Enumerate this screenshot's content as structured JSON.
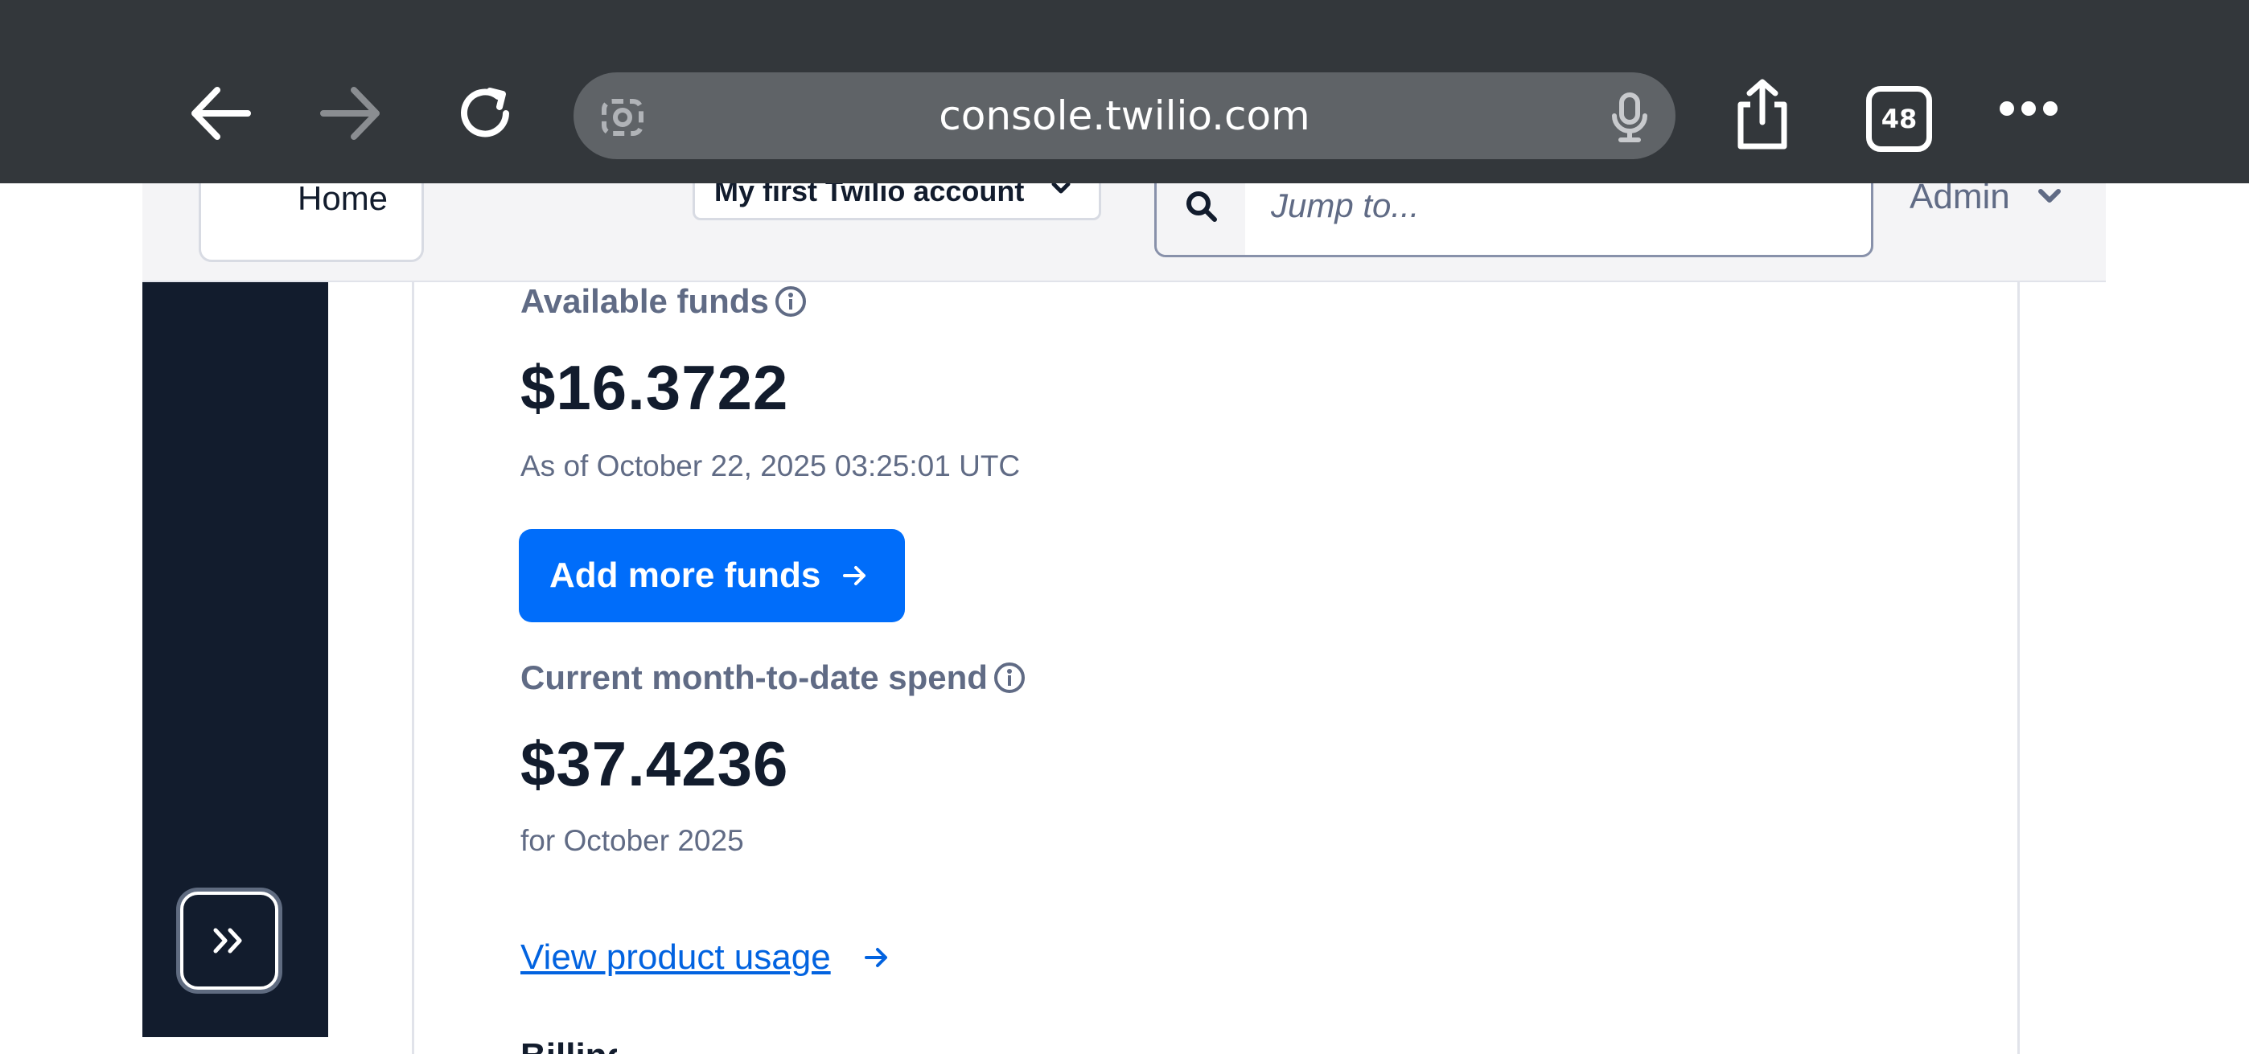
{
  "browser": {
    "url": "console.twilio.com",
    "tabs_count": "48"
  },
  "header": {
    "home_label": "Home",
    "account_selector": "My first Twilio account",
    "search_placeholder": "Jump to...",
    "admin_label": "Admin"
  },
  "billing": {
    "available_funds_label": "Available funds",
    "available_funds_amount": "$16.3722",
    "available_funds_asof": "As of October 22, 2025 03:25:01 UTC",
    "add_funds_button": "Add more funds",
    "mtd_spend_label": "Current month-to-date spend",
    "mtd_spend_amount": "$37.4236",
    "mtd_spend_period": "for October 2025",
    "view_usage_link": "View product usage",
    "next_section_partial": "Billing"
  },
  "colors": {
    "chrome_bg": "#33373b",
    "sidebar_bg": "#121c2d",
    "primary_button": "#006dfa",
    "link": "#0263e0",
    "muted_text": "#606b85"
  }
}
